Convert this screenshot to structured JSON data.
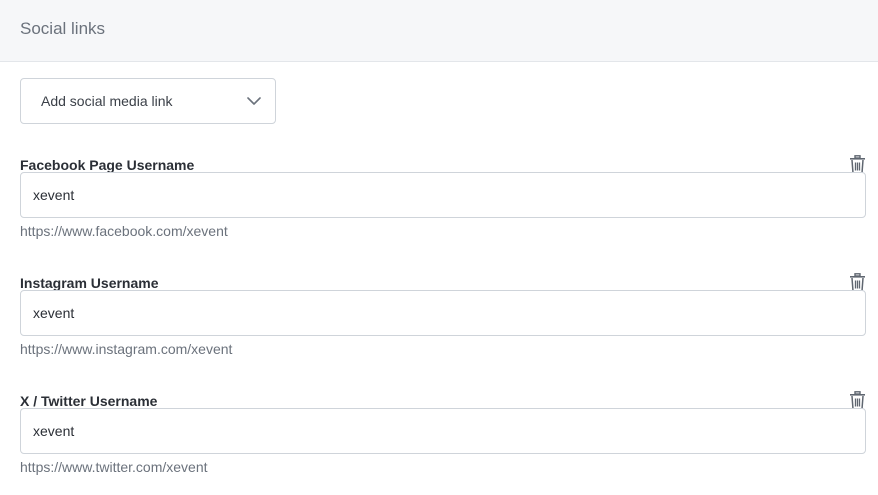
{
  "panel": {
    "title": "Social links"
  },
  "add_link": {
    "label": "Add social media link",
    "icon": "chevron-down-icon"
  },
  "fields": [
    {
      "label": "Facebook Page Username",
      "value": "xevent",
      "help": "https://www.facebook.com/xevent",
      "icon": "trash-icon"
    },
    {
      "label": "Instagram Username",
      "value": "xevent",
      "help": "https://www.instagram.com/xevent",
      "icon": "trash-icon"
    },
    {
      "label": "X / Twitter Username",
      "value": "xevent",
      "help": "https://www.twitter.com/xevent",
      "icon": "trash-icon"
    }
  ]
}
